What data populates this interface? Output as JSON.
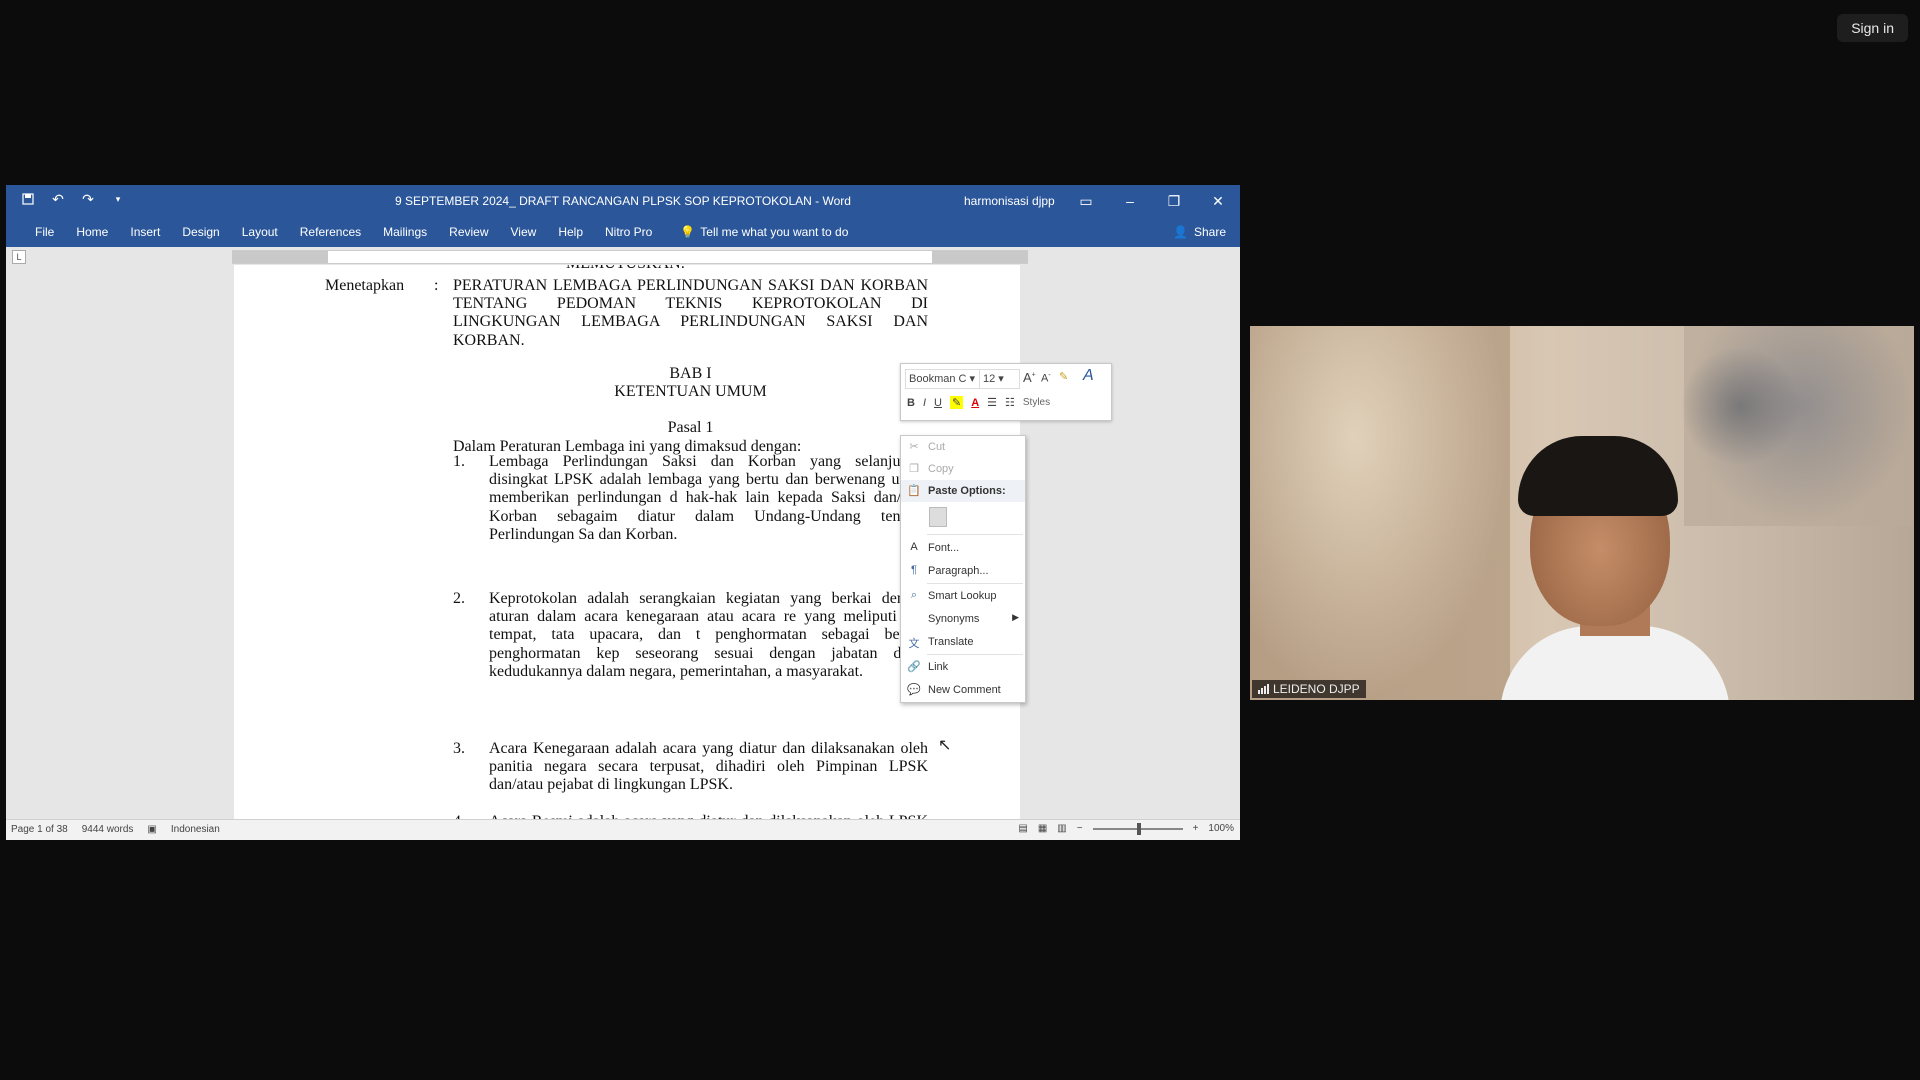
{
  "meeting": {
    "sign_in_label": "Sign in"
  },
  "word": {
    "title": "9 SEPTEMBER 2024_ DRAFT RANCANGAN PLPSK SOP KEPROTOKOLAN  -  Word",
    "user": "harmonisasi djpp",
    "tabs": [
      "File",
      "Home",
      "Insert",
      "Design",
      "Layout",
      "References",
      "Mailings",
      "Review",
      "View",
      "Help",
      "Nitro Pro"
    ],
    "tell_me": "Tell me what you want to do",
    "share": "Share",
    "document": {
      "prev_line": "MEMUTUSKAN:",
      "menetapkan_label": "Menetapkan",
      "colon": ":",
      "menetapkan_text": "PERATURAN LEMBAGA PERLINDUNGAN SAKSI DAN KORBAN TENTANG PEDOMAN TEKNIS KEPROTOKOLAN DI LINGKUNGAN LEMBAGA PERLINDUNGAN SAKSI DAN KORBAN.",
      "bab": "BAB I",
      "bab_title": "KETENTUAN UMUM",
      "pasal": "Pasal 1",
      "intro": "Dalam Peraturan Lembaga ini yang dimaksud dengan:",
      "items": [
        {
          "num": "1.",
          "text": "Lembaga Perlindungan Saksi dan Korban yang selanjutnya disingkat LPSK adalah lembaga yang bertu dan berwenang untuk memberikan perlindungan d hak-hak lain kepada Saksi dan/atau Korban sebagaim diatur dalam Undang-Undang tentang Perlindungan Sa dan Korban."
        },
        {
          "num": "2.",
          "text": "Keprotokolan adalah serangkaian kegiatan yang berkai dengan aturan dalam acara kenegaraan atau acara re yang meliputi tata tempat, tata upacara, dan t penghormatan sebagai bentuk penghormatan kep seseorang sesuai dengan jabatan dan/a kedudukannya dalam negara, pemerintahan, a masyarakat."
        },
        {
          "num": "3.",
          "text": "Acara Kenegaraan adalah acara yang diatur dan dilaksanakan oleh panitia negara secara terpusat, dihadiri oleh Pimpinan LPSK dan/atau pejabat di lingkungan LPSK."
        },
        {
          "num": "4.",
          "text": "Acara Resmi adalah acara yang diatur dan dilaksanakan oleh LPSK dalam melaksanakan tugas dan fungsi tertentu dan dihadiri oleh Pimpinan LPSK, eselon I di lingkungan"
        }
      ]
    },
    "status": {
      "page": "Page 1 of 38",
      "words": "9444 words",
      "language": "Indonesian",
      "zoom": "100%"
    },
    "mini_toolbar": {
      "font": "Bookman C",
      "size": "12",
      "styles_label": "Styles"
    },
    "context_menu": {
      "cut": "Cut",
      "copy": "Copy",
      "paste_options": "Paste Options:",
      "font": "Font...",
      "paragraph": "Paragraph...",
      "smart_lookup": "Smart Lookup",
      "synonyms": "Synonyms",
      "translate": "Translate",
      "link": "Link",
      "new_comment": "New Comment"
    }
  },
  "video": {
    "participant_name": "LEIDENO DJPP"
  }
}
